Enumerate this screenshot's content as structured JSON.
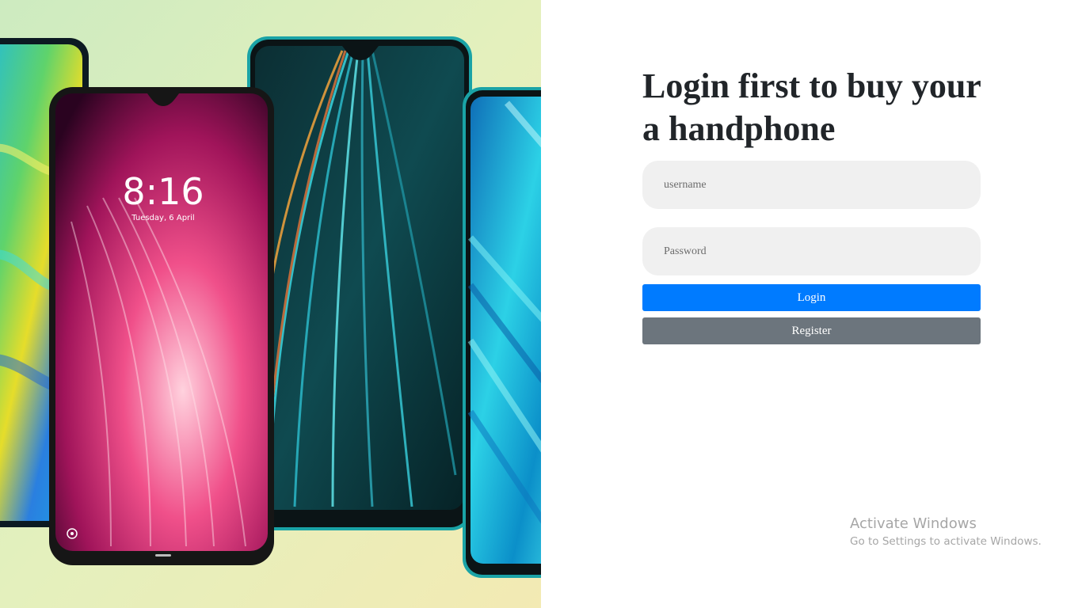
{
  "login": {
    "heading": "Login first to buy your a handphone",
    "username_placeholder": "username",
    "password_placeholder": "Password",
    "login_label": "Login",
    "register_label": "Register"
  },
  "hero": {
    "lockscreen_time": "8:16",
    "lockscreen_date": "Tuesday, 6 April"
  },
  "watermark": {
    "line1": "Activate Windows",
    "line2": "Go to Settings to activate Windows."
  },
  "colors": {
    "primary": "#007bff",
    "secondary": "#6c757d",
    "input_bg": "#f0f0f0",
    "heading": "#212529"
  }
}
